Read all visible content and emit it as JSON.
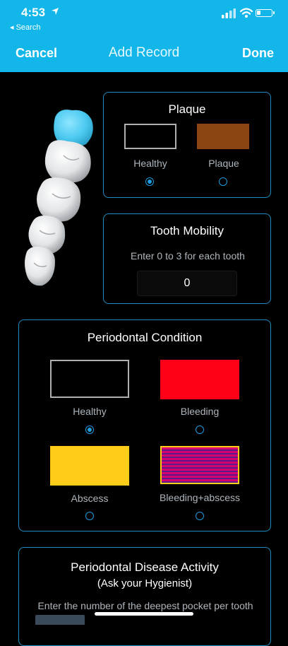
{
  "status": {
    "time": "4:53",
    "back_label": "◂ Search"
  },
  "nav": {
    "cancel": "Cancel",
    "title": "Add Record",
    "done": "Done"
  },
  "plaque": {
    "title": "Plaque",
    "options": [
      {
        "label": "Healthy",
        "color": "#000000",
        "selected": true
      },
      {
        "label": "Plaque",
        "color": "#8b4513",
        "selected": false
      }
    ]
  },
  "mobility": {
    "title": "Tooth Mobility",
    "hint": "Enter 0 to 3 for each tooth",
    "value": "0"
  },
  "periodontal": {
    "title": "Periodontal Condition",
    "options": [
      {
        "label": "Healthy",
        "color": "#000000",
        "selected": true
      },
      {
        "label": "Bleeding",
        "color": "#ff0019",
        "selected": false
      },
      {
        "label": "Abscess",
        "color": "#ffcc1a",
        "selected": false
      },
      {
        "label": "Bleeding+abscess",
        "color": "#d6006e",
        "selected": false
      }
    ]
  },
  "disease": {
    "title": "Periodontal Disease Activity",
    "subtitle": "(Ask your Hygienist)",
    "hint": "Enter the number of the deepest pocket per tooth"
  },
  "colors": {
    "accent": "#12b6e8",
    "card_border": "#1f8cc0",
    "radio": "#1f9be0"
  }
}
